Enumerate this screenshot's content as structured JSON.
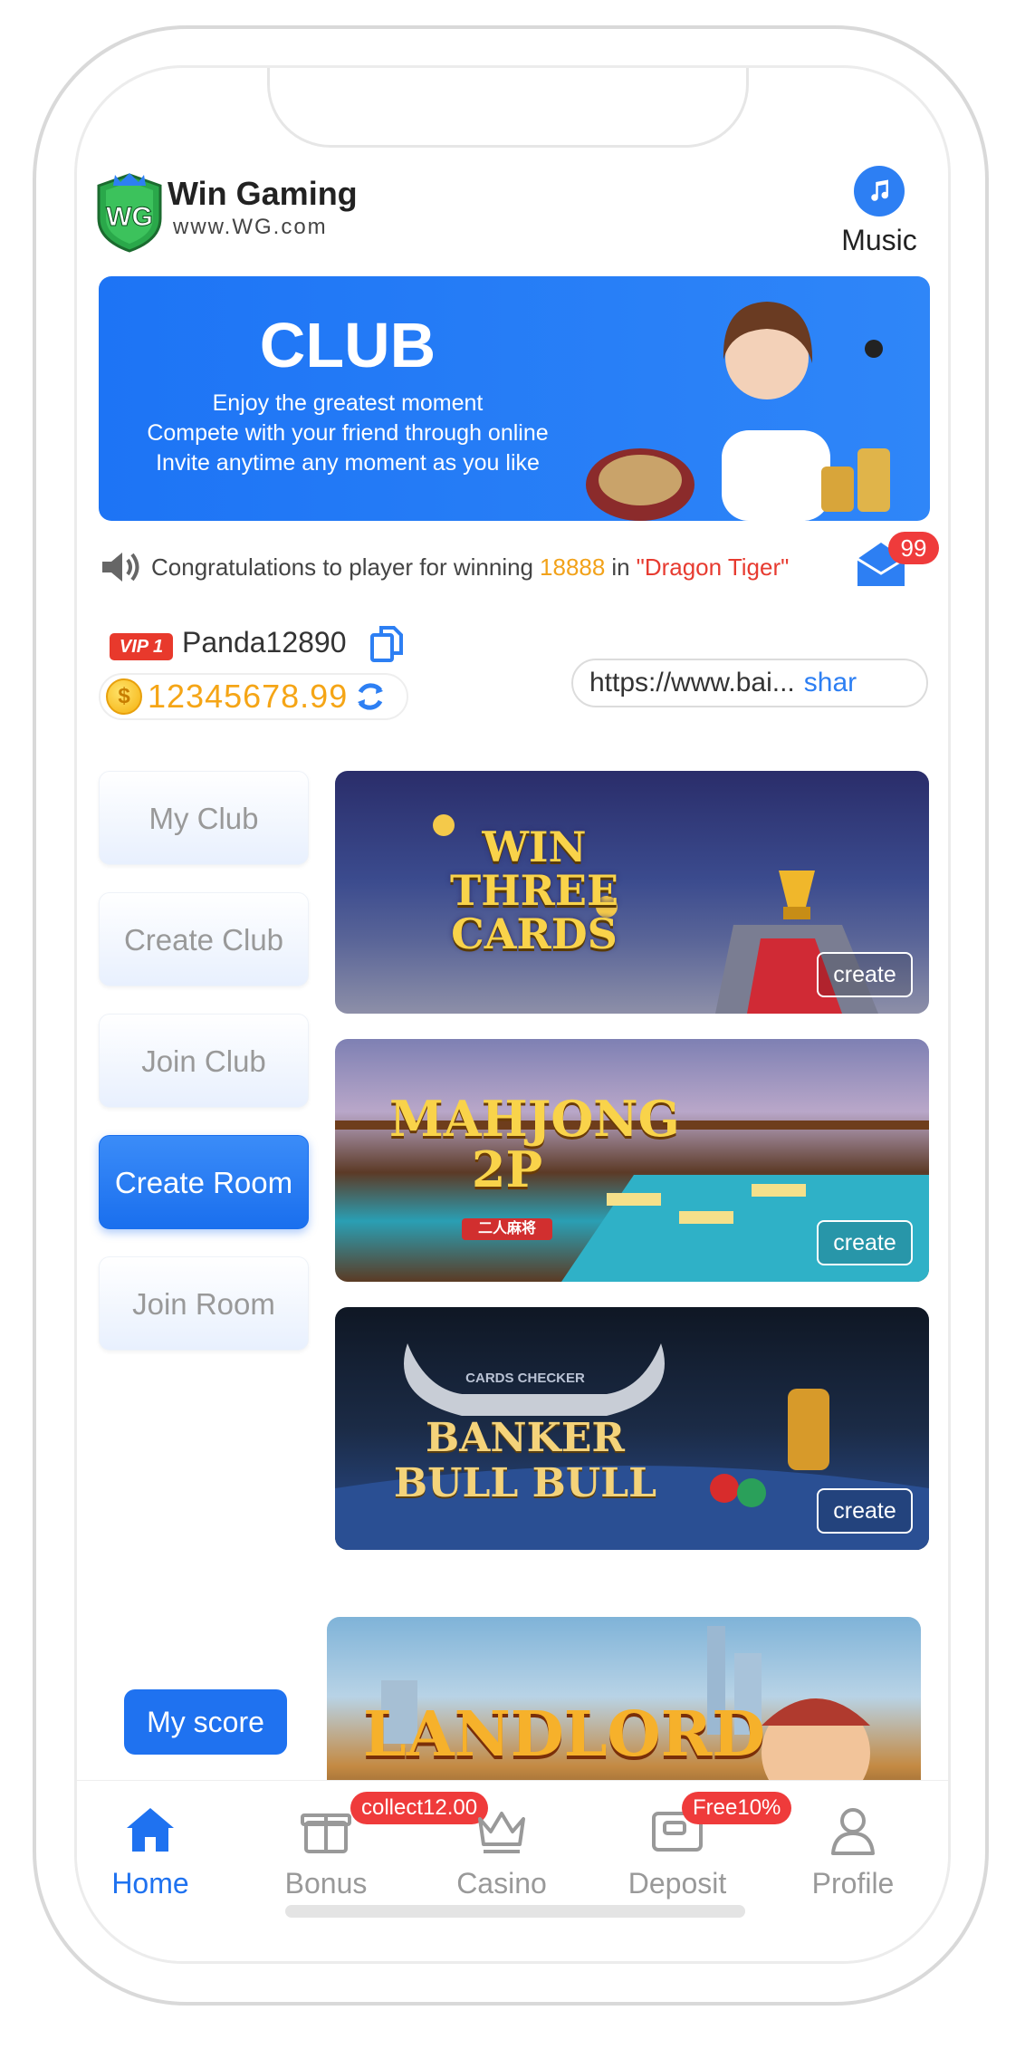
{
  "brand": {
    "name": "Win Gaming",
    "url": "www.WG.com",
    "logo_text": "WG"
  },
  "header": {
    "music_label": "Music"
  },
  "banner": {
    "title": "CLUB",
    "lines": [
      "Enjoy the greatest moment",
      "Compete with your friend through online",
      "Invite anytime any moment as you like"
    ]
  },
  "marquee": {
    "prefix": "Congratulations to player for winning",
    "amount": "18888",
    "connector": "in",
    "game": "\"Dragon Tiger\""
  },
  "mail": {
    "badge": "99"
  },
  "user": {
    "vip": "VIP 1",
    "name": "Panda12890",
    "coin_symbol": "$",
    "balance": "12345678.99",
    "share_url": "https://www.bai...",
    "share_label": "shar"
  },
  "side_menu": [
    {
      "label": "My Club",
      "active": false
    },
    {
      "label": "Create Club",
      "active": false
    },
    {
      "label": "Join Club",
      "active": false
    },
    {
      "label": "Create Room",
      "active": true
    },
    {
      "label": "Join Room",
      "active": false
    }
  ],
  "games": [
    {
      "title": "WIN THREE CARDS",
      "action": "create"
    },
    {
      "title": "MAHJONG 2P",
      "subtitle": "二人麻将",
      "action": "create"
    },
    {
      "title": "BANKER BULL BULL",
      "subtitle": "CARDS CHECKER",
      "action": "create"
    },
    {
      "title": "LANDLORD"
    }
  ],
  "my_score_label": "My score",
  "bottom_nav": [
    {
      "label": "Home",
      "icon": "home-icon",
      "active": true
    },
    {
      "label": "Bonus",
      "icon": "gift-icon",
      "badge": "collect12.00"
    },
    {
      "label": "Casino",
      "icon": "crown-icon"
    },
    {
      "label": "Deposit",
      "icon": "wallet-icon",
      "badge": "Free10%"
    },
    {
      "label": "Profile",
      "icon": "user-icon"
    }
  ],
  "colors": {
    "primary": "#1f72f0",
    "accent_gold": "#f5a516",
    "badge_red": "#ef3b3b"
  }
}
